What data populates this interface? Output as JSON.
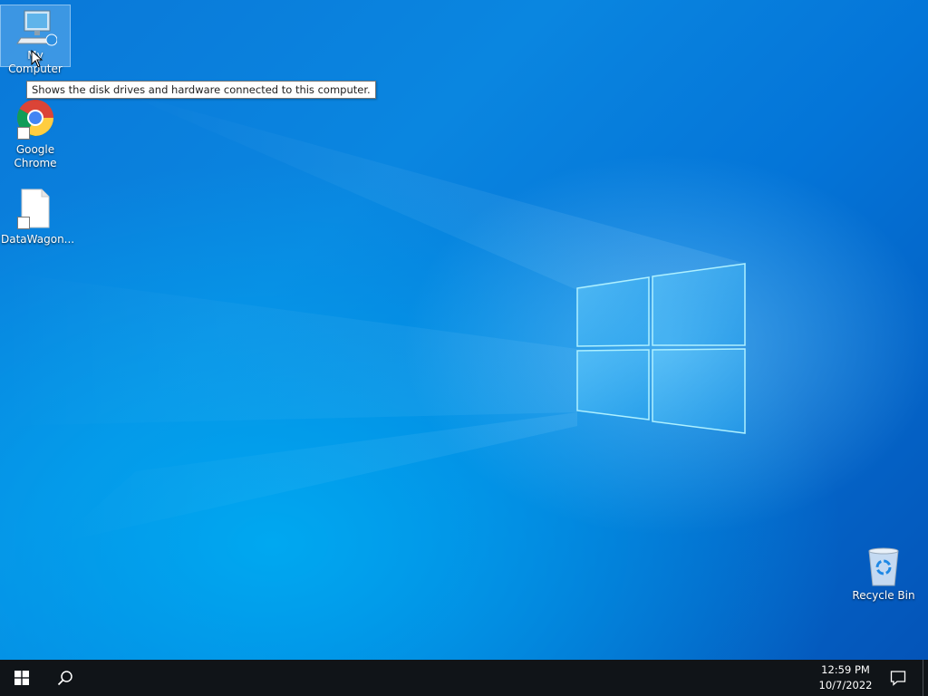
{
  "desktop": {
    "icons": [
      {
        "label": "My Computer",
        "icon": "computer-icon",
        "selected": true
      },
      {
        "label": "Google Chrome",
        "label_line1": "Google",
        "label_line2": "Chrome",
        "icon": "chrome-icon",
        "shortcut": true
      },
      {
        "label": "DataWagon...",
        "icon": "file-icon",
        "shortcut": true
      },
      {
        "label": "Recycle Bin",
        "icon": "recycle-bin-icon"
      }
    ],
    "tooltip": "Shows the disk drives and hardware connected to this computer."
  },
  "taskbar": {
    "start_icon": "windows-logo-icon",
    "search_icon": "search-icon",
    "time": "12:59 PM",
    "date": "10/7/2022",
    "notification_icon": "action-center-icon"
  },
  "colors": {
    "wallpaper_blue": "#0a78d8",
    "taskbar": "#101418",
    "logo_light": "#7fd8ff"
  }
}
